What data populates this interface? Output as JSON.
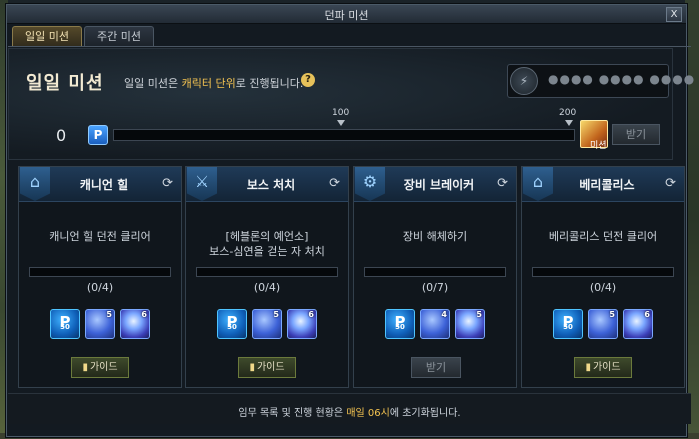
{
  "window": {
    "title": "던파 미션",
    "close_label": "X"
  },
  "tabs": [
    {
      "label": "일일 미션",
      "active": true
    },
    {
      "label": "주간 미션",
      "active": false
    }
  ],
  "header": {
    "title": "일일 미션",
    "notice_pre": "일일 미션은 ",
    "notice_highlight": "캐릭터 단위",
    "notice_post": "로 진행됩니다.",
    "help_label": "?",
    "ic_dots": "●●●● ●●●● ●●●●"
  },
  "progress": {
    "count": "0",
    "p_label": "P",
    "current": 0,
    "max": 200,
    "milestone_100": "100",
    "milestone_200": "200",
    "chest_label": "미션",
    "receive_label": "받기"
  },
  "missions": [
    {
      "title": "캐니언 힐",
      "desc_line1": "캐니언 힐 던전 클리어",
      "desc_line2": "",
      "count": "(0/4)",
      "pcoin_sub": "50",
      "item1_count": "5",
      "item2_count": "6",
      "button": "가이드",
      "button_type": "guide"
    },
    {
      "title": "보스 처치",
      "desc_line1": "[헤블론의 예언소]",
      "desc_line2": "보스-심연을 걷는 자 처치",
      "count": "(0/4)",
      "pcoin_sub": "50",
      "item1_count": "5",
      "item2_count": "6",
      "button": "가이드",
      "button_type": "guide"
    },
    {
      "title": "장비 브레이커",
      "desc_line1": "장비 해체하기",
      "desc_line2": "",
      "count": "(0/7)",
      "pcoin_sub": "50",
      "item1_count": "4",
      "item2_count": "5",
      "button": "받기",
      "button_type": "claim"
    },
    {
      "title": "베리콜리스",
      "desc_line1": "베리콜리스 던전 클리어",
      "desc_line2": "",
      "count": "(0/4)",
      "pcoin_sub": "50",
      "item1_count": "5",
      "item2_count": "6",
      "button": "가이드",
      "button_type": "guide"
    }
  ],
  "footer": {
    "pre": "임무 목록 및 진행 현황은 ",
    "highlight": "매일 06시",
    "post": "에 초기화됩니다."
  },
  "colors": {
    "highlight": "#f5c451",
    "progress_fill": "#3a8f3a",
    "card_header": "#1f3a57"
  }
}
